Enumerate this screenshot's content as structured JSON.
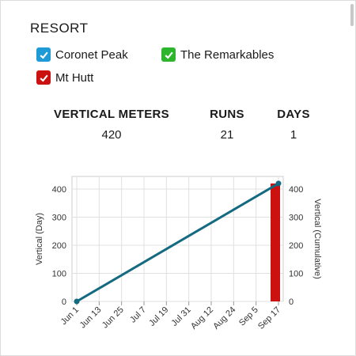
{
  "resort_label": "RESORT",
  "resorts": [
    {
      "name": "Coronet Peak",
      "checked": true,
      "color": "#1e9bd7"
    },
    {
      "name": "The Remarkables",
      "checked": true,
      "color": "#2db52d"
    },
    {
      "name": "Mt Hutt",
      "checked": true,
      "color": "#cc1111"
    }
  ],
  "stats": [
    {
      "label": "VERTICAL METERS",
      "value": "420"
    },
    {
      "label": "RUNS",
      "value": "21"
    },
    {
      "label": "DAYS",
      "value": "1"
    }
  ],
  "chart_data": {
    "type": "bar",
    "x_ticks": [
      "Jun 1",
      "Jun 13",
      "Jun 25",
      "Jul 7",
      "Jul 19",
      "Jul 31",
      "Aug 12",
      "Aug 24",
      "Sep 5",
      "Sep 17"
    ],
    "xlim": [
      "Jun 1",
      "Sep 17"
    ],
    "ylabel": "Vertical (Day)",
    "y2label": "Vertical (Cumulative)",
    "ylim": [
      0,
      420
    ],
    "y_ticks": [
      0,
      100,
      200,
      300,
      400
    ],
    "y2_ticks": [
      0,
      100,
      200,
      300,
      400
    ],
    "grid": true,
    "series": [
      {
        "type": "bar",
        "axis": "left",
        "color": "#cc1111",
        "points": [
          {
            "x": "Sep 17",
            "y": 420
          }
        ]
      },
      {
        "type": "line",
        "axis": "right",
        "color": "#146a80",
        "points": [
          {
            "x": "Jun 1",
            "y": 0
          },
          {
            "x": "Sep 17",
            "y": 420
          }
        ]
      }
    ]
  }
}
